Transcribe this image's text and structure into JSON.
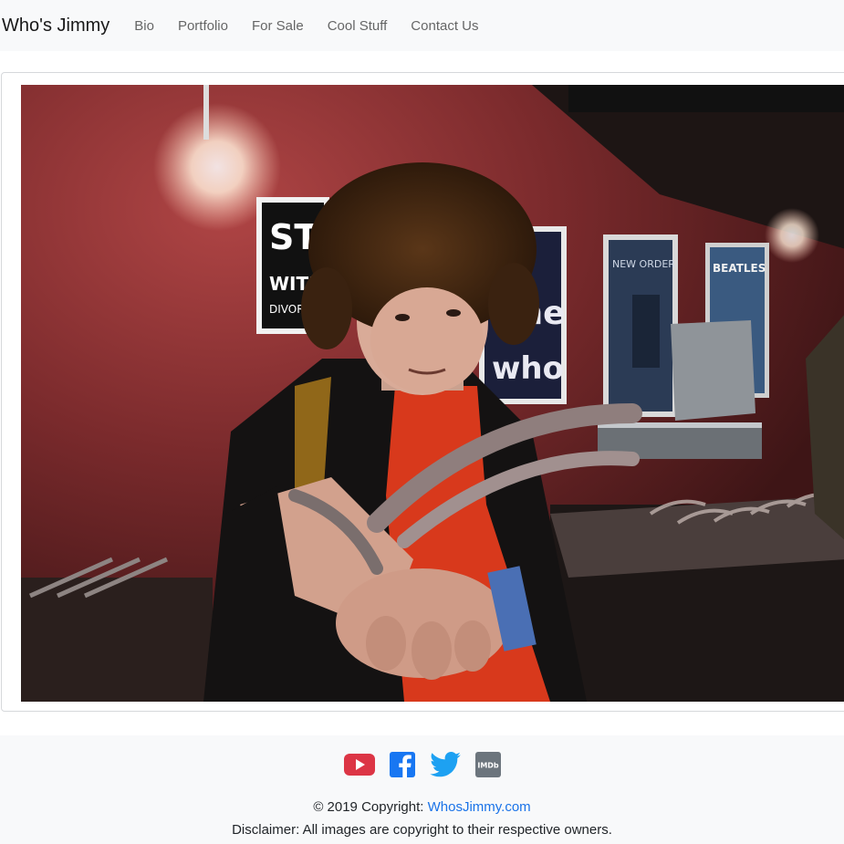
{
  "navbar": {
    "brand": "Who's Jimmy",
    "links": [
      "Bio",
      "Portfolio",
      "For Sale",
      "Cool Stuff",
      "Contact Us"
    ]
  },
  "main": {
    "poster_texts": {
      "left": "ST",
      "left_sub1": "WITH",
      "left_sub2": "DIVORCE",
      "middle_line1": "The",
      "middle_line2": "who",
      "new_order": "NEW ORDER",
      "beatles": "BEATLES"
    }
  },
  "footer": {
    "social_icons": [
      "youtube-icon",
      "facebook-icon",
      "twitter-icon",
      "imdb-icon"
    ],
    "imdb_label": "IMDb",
    "copyright_prefix": "© 2019 Copyright: ",
    "copyright_link": "WhosJimmy.com",
    "disclaimer": "Disclaimer: All images are copyright to their respective owners.",
    "colors": {
      "youtube": "#dc3545",
      "facebook": "#1877f2",
      "twitter": "#1da1f2",
      "imdb": "#6c757d",
      "link": "#1a73e8"
    }
  }
}
